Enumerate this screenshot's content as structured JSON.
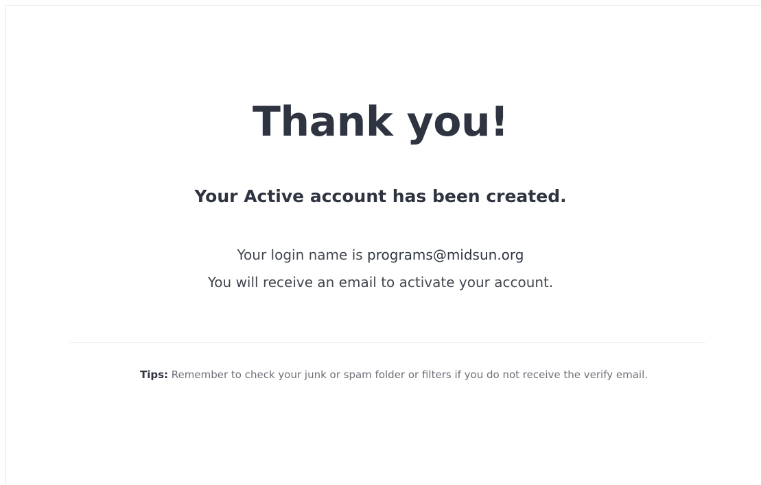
{
  "confirmation": {
    "title": "Thank you!",
    "subtitle": "Your Active account has been created.",
    "login_prefix": "Your login name is ",
    "login_name": "programs@midsun.org",
    "activation_note": "You will receive an email to activate your account."
  },
  "tips": {
    "label": "Tips:",
    "text": " Remember to check your junk or spam folder or filters if you do not receive the verify email."
  },
  "colors": {
    "heading": "#2e3440",
    "body_text": "#41464f",
    "muted_text": "#6b6f76",
    "divider": "#e6e6e6",
    "card_border": "#e3e3e3"
  }
}
